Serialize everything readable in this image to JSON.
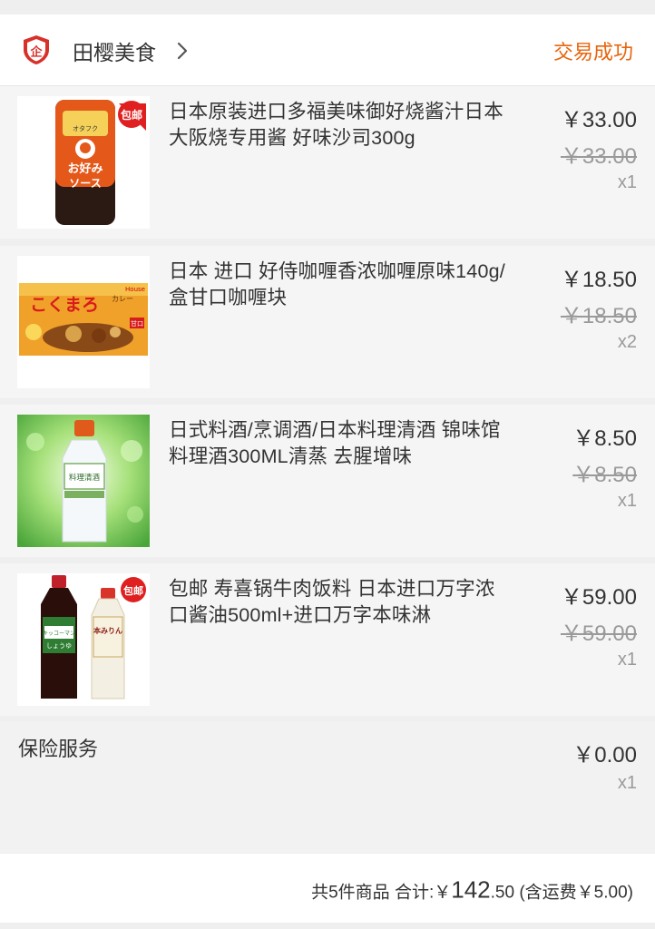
{
  "shop": {
    "name": "田樱美食",
    "status": "交易成功",
    "badge_glyph": "企",
    "status_color": "#e8650d"
  },
  "items": [
    {
      "title": "日本原装进口多福美味御好烧酱汁日本大阪烧专用酱 好味沙司300g",
      "price": "￥33.00",
      "original_price": "￥33.00",
      "qty": "x1",
      "badge": "包邮",
      "image_text": [
        "お好み",
        "ソース",
        "オタフク"
      ]
    },
    {
      "title": "日本 进口 好侍咖喱香浓咖喱原味140g/盒甘口咖喱块",
      "price": "￥18.50",
      "original_price": "￥18.50",
      "qty": "x2",
      "image_text": [
        "こくまろ",
        "カレー",
        "House",
        "甘口"
      ]
    },
    {
      "title": "日式料酒/烹调酒/日本料理清酒 锦味馆料理酒300ML清蒸 去腥增味",
      "price": "￥8.50",
      "original_price": "￥8.50",
      "qty": "x1",
      "image_text": [
        "料理清酒"
      ]
    },
    {
      "title": "包邮 寿喜锅牛肉饭料 日本进口万字浓口酱油500ml+进口万字本味淋",
      "price": "￥59.00",
      "original_price": "￥59.00",
      "qty": "x1",
      "badge": "包邮",
      "image_text": [
        "キッコーマン",
        "しょうゆ",
        "本みりん"
      ]
    }
  ],
  "insurance": {
    "label": "保险服务",
    "price": "￥0.00",
    "qty": "x1"
  },
  "summary": {
    "count_text": "共5件商品",
    "total_label": "合计:",
    "currency": "￥",
    "total_int": "142",
    "total_dec": ".50",
    "shipping": "(含运费￥5.00)"
  }
}
